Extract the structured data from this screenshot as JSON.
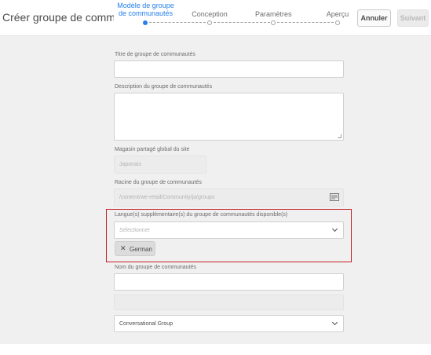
{
  "header": {
    "title": "Créer groupe de communautés",
    "steps": [
      {
        "label": "Modèle de groupe de communautés",
        "state": "active"
      },
      {
        "label": "Conception",
        "state": "todo"
      },
      {
        "label": "Paramètres",
        "state": "todo"
      },
      {
        "label": "Aperçu",
        "state": "todo"
      }
    ],
    "cancel_label": "Annuler",
    "next_label": "Suivant"
  },
  "form": {
    "title_label": "Titre de groupe de communautés",
    "title_value": "",
    "description_label": "Description du groupe de communautés",
    "description_value": "",
    "store_label": "Magasin partagé global du site",
    "store_value": "Japonais",
    "root_label": "Racine du groupe de communautés",
    "root_value": "/content/we-retail/Community/ja/groups",
    "languages_label": "Langue(s) supplémentaire(s) du groupe de communautés disponible(s)",
    "languages_placeholder": "Sélectionner",
    "selected_language": "German",
    "name_label": "Nom du groupe de communautés",
    "name_value": "",
    "type_value": "Conversational Group"
  },
  "colors": {
    "accent": "#2680eb",
    "highlight_border": "#c02026"
  }
}
